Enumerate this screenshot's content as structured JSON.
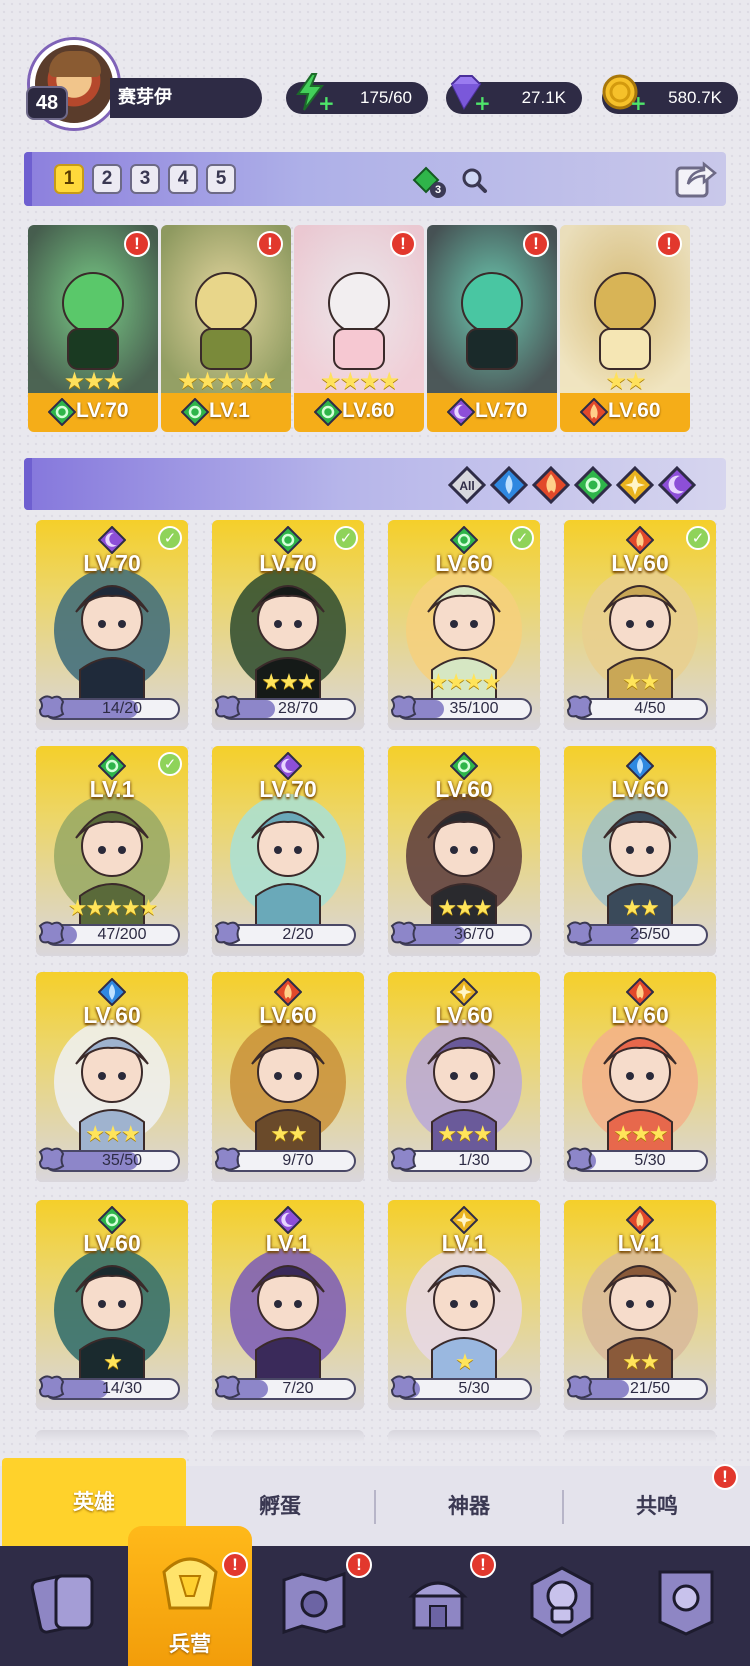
{
  "player": {
    "level": "48",
    "name": "赛芽伊"
  },
  "resources": [
    {
      "icon": "energy-icon",
      "value": "175/60",
      "color": "#43d05a"
    },
    {
      "icon": "gem-icon",
      "value": "27.1K",
      "color": "#8e6ee8"
    },
    {
      "icon": "coin-icon",
      "value": "580.7K",
      "color": "#f6c12a"
    }
  ],
  "team": {
    "tabs": [
      "1",
      "2",
      "3",
      "4",
      "5"
    ],
    "active_tab": "1",
    "gem_count": "3",
    "members": [
      {
        "level": "LV.70",
        "stars": "★★★",
        "element": "nature",
        "alert": "!"
      },
      {
        "level": "LV.1",
        "stars": "★★★★★",
        "element": "nature",
        "alert": "!"
      },
      {
        "level": "LV.60",
        "stars": "★★★★",
        "element": "nature",
        "alert": "!"
      },
      {
        "level": "LV.70",
        "stars": "",
        "element": "dark",
        "alert": "!"
      },
      {
        "level": "LV.60",
        "stars": "★★",
        "element": "fire",
        "alert": "!"
      }
    ]
  },
  "filters": [
    {
      "id": "all",
      "label": "All"
    },
    {
      "id": "water",
      "label": ""
    },
    {
      "id": "fire",
      "label": ""
    },
    {
      "id": "nature",
      "label": ""
    },
    {
      "id": "light",
      "label": ""
    },
    {
      "id": "dark",
      "label": ""
    }
  ],
  "heroes": [
    {
      "level": "LV.70",
      "fragments": "14/20",
      "progress": 0.7,
      "element": "dark",
      "checked": true,
      "stars": "",
      "colors": [
        "#3b6a7a",
        "#1f2a3a"
      ]
    },
    {
      "level": "LV.70",
      "fragments": "28/70",
      "progress": 0.4,
      "element": "nature",
      "checked": true,
      "stars": "★★★",
      "colors": [
        "#2c4a2e",
        "#151a18"
      ]
    },
    {
      "level": "LV.60",
      "fragments": "35/100",
      "progress": 0.35,
      "element": "nature",
      "checked": true,
      "stars": "★★★★",
      "colors": [
        "#f6d07c",
        "#d6e7c3"
      ]
    },
    {
      "level": "LV.60",
      "fragments": "4/50",
      "progress": 0.08,
      "element": "fire",
      "checked": true,
      "stars": "★★",
      "colors": [
        "#e9cf8e",
        "#c9a756"
      ]
    },
    {
      "level": "LV.1",
      "fragments": "47/200",
      "progress": 0.235,
      "element": "nature",
      "checked": true,
      "stars": "★★★★★",
      "colors": [
        "#96a864",
        "#5a6a3a"
      ]
    },
    {
      "level": "LV.70",
      "fragments": "2/20",
      "progress": 0.1,
      "element": "dark",
      "checked": false,
      "stars": "",
      "colors": [
        "#a8e1d6",
        "#6aa9b9"
      ]
    },
    {
      "level": "LV.60",
      "fragments": "36/70",
      "progress": 0.514,
      "element": "nature",
      "checked": false,
      "stars": "★★★",
      "colors": [
        "#5a3a3a",
        "#2a2a2e"
      ]
    },
    {
      "level": "LV.60",
      "fragments": "25/50",
      "progress": 0.5,
      "element": "water",
      "checked": false,
      "stars": "★★",
      "colors": [
        "#9fc1c8",
        "#3a4a5a"
      ]
    },
    {
      "level": "LV.60",
      "fragments": "35/50",
      "progress": 0.7,
      "element": "water",
      "checked": false,
      "stars": "★★★",
      "colors": [
        "#eef1f6",
        "#9fb3cf"
      ]
    },
    {
      "level": "LV.60",
      "fragments": "9/70",
      "progress": 0.13,
      "element": "fire",
      "checked": false,
      "stars": "★★",
      "colors": [
        "#c9903a",
        "#6a4a2a"
      ]
    },
    {
      "level": "LV.60",
      "fragments": "1/30",
      "progress": 0.033,
      "element": "light",
      "checked": false,
      "stars": "★★★",
      "colors": [
        "#b8a8d8",
        "#6a5a9a"
      ]
    },
    {
      "level": "LV.60",
      "fragments": "5/30",
      "progress": 0.167,
      "element": "fire",
      "checked": false,
      "stars": "★★★",
      "colors": [
        "#f3b08a",
        "#e7684c"
      ]
    },
    {
      "level": "LV.60",
      "fragments": "14/30",
      "progress": 0.467,
      "element": "nature",
      "checked": false,
      "stars": "★",
      "colors": [
        "#2c6a6a",
        "#1a2a2e"
      ]
    },
    {
      "level": "LV.1",
      "fragments": "7/20",
      "progress": 0.35,
      "element": "dark",
      "checked": false,
      "stars": "",
      "colors": [
        "#7a5ab8",
        "#3a2a5a"
      ]
    },
    {
      "level": "LV.1",
      "fragments": "5/30",
      "progress": 0.167,
      "element": "light",
      "checked": false,
      "stars": "★",
      "colors": [
        "#e8d8e8",
        "#9ab8e0"
      ]
    },
    {
      "level": "LV.1",
      "fragments": "21/50",
      "progress": 0.42,
      "element": "fire",
      "checked": false,
      "stars": "★★",
      "colors": [
        "#d8b89a",
        "#8a5a3a"
      ]
    }
  ],
  "subtabs": [
    {
      "label": "英雄",
      "active": true,
      "alert": ""
    },
    {
      "label": "孵蛋",
      "active": false,
      "alert": ""
    },
    {
      "label": "神器",
      "active": false,
      "alert": ""
    },
    {
      "label": "共鸣",
      "active": false,
      "alert": "!"
    }
  ],
  "nav": [
    {
      "icon": "cards-icon",
      "label": "",
      "alert": ""
    },
    {
      "icon": "barracks-icon",
      "label": "兵营",
      "alert": "!",
      "active": true
    },
    {
      "icon": "map-icon",
      "label": "",
      "alert": "!"
    },
    {
      "icon": "temple-icon",
      "label": "",
      "alert": "!"
    },
    {
      "icon": "guild-icon",
      "label": "",
      "alert": ""
    },
    {
      "icon": "banner-icon",
      "label": "",
      "alert": ""
    }
  ],
  "element_colors": {
    "nature": "#2fb54a",
    "dark": "#8d4fd8",
    "fire": "#e2492a",
    "water": "#2f88e0",
    "light": "#e8b21e"
  }
}
